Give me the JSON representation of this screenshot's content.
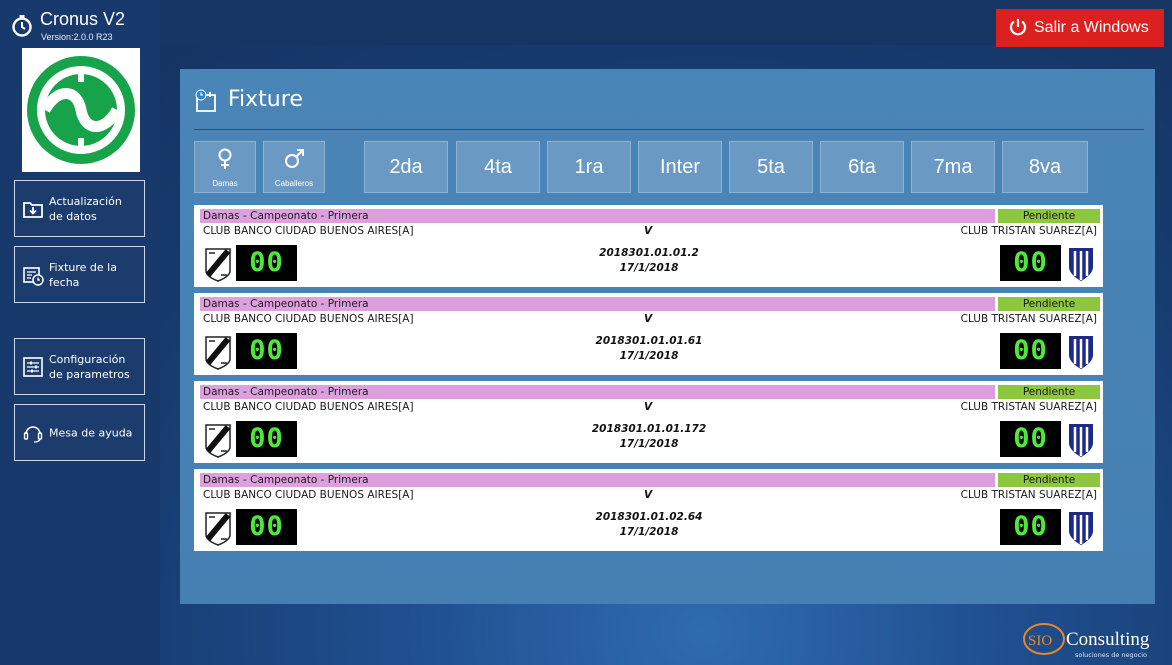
{
  "app": {
    "title": "Cronus V2",
    "version": "Version:2.0.0 R23",
    "exit_label": "Salir a Windows"
  },
  "sidebar": {
    "items": [
      {
        "label": "Actualización\nde datos",
        "icon": "download-folder-icon"
      },
      {
        "label": "Fixture de la\nfecha",
        "icon": "calendar-clock-icon"
      },
      {
        "label": "Configuración\nde parametros",
        "icon": "settings-sliders-icon"
      },
      {
        "label": "Mesa de ayuda",
        "icon": "headset-icon"
      }
    ]
  },
  "fixture": {
    "title": "Fixture",
    "gender_filters": [
      {
        "label": "Damas",
        "icon": "female-symbol-icon"
      },
      {
        "label": "Caballeros",
        "icon": "male-symbol-icon"
      }
    ],
    "categories": [
      "2da",
      "4ta",
      "1ra",
      "Inter",
      "5ta",
      "6ta",
      "7ma",
      "8va"
    ],
    "matches": [
      {
        "category": "Damas - Campeonato - Primera",
        "status": "Pendiente",
        "home": "CLUB BANCO CIUDAD BUENOS AIRES[A]",
        "away": "CLUB TRISTAN SUAREZ[A]",
        "vs": "V",
        "code": "2018301.01.01.2",
        "date": "17/1/2018",
        "home_score": "00",
        "away_score": "00"
      },
      {
        "category": "Damas - Campeonato - Primera",
        "status": "Pendiente",
        "home": "CLUB BANCO CIUDAD BUENOS AIRES[A]",
        "away": "CLUB TRISTAN SUAREZ[A]",
        "vs": "V",
        "code": "2018301.01.01.61",
        "date": "17/1/2018",
        "home_score": "00",
        "away_score": "00"
      },
      {
        "category": "Damas - Campeonato - Primera",
        "status": "Pendiente",
        "home": "CLUB BANCO CIUDAD BUENOS AIRES[A]",
        "away": "CLUB TRISTAN SUAREZ[A]",
        "vs": "V",
        "code": "2018301.01.01.172",
        "date": "17/1/2018",
        "home_score": "00",
        "away_score": "00"
      },
      {
        "category": "Damas - Campeonato - Primera",
        "status": "Pendiente",
        "home": "CLUB BANCO CIUDAD BUENOS AIRES[A]",
        "away": "CLUB TRISTAN SUAREZ[A]",
        "vs": "V",
        "code": "2018301.01.02.64",
        "date": "17/1/2018",
        "home_score": "00",
        "away_score": "00"
      }
    ]
  },
  "brand": {
    "name": "Consulting",
    "prefix": "SIO",
    "tagline": "soluciones de negocio"
  },
  "colors": {
    "exit": "#dc2020",
    "category_bar": "#dda0dd",
    "status": "#8dc63f",
    "score_digits": "#4ee83a",
    "panel": "#4682b4"
  }
}
